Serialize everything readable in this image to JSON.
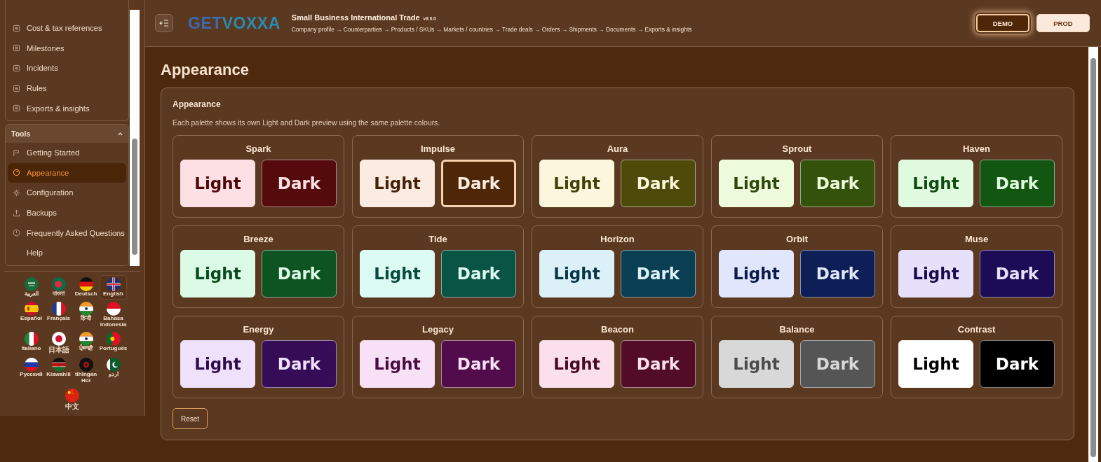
{
  "sidebar": {
    "items": [
      {
        "label": "Cost & tax references",
        "selected": false
      },
      {
        "label": "Milestones",
        "selected": false
      },
      {
        "label": "Incidents",
        "selected": false
      },
      {
        "label": "Rules",
        "selected": false
      },
      {
        "label": "Exports & insights",
        "selected": false
      }
    ],
    "tools": {
      "title": "Tools",
      "expanded": true,
      "items": [
        {
          "label": "Getting Started",
          "selected": false
        },
        {
          "label": "Appearance",
          "selected": true
        },
        {
          "label": "Configuration",
          "selected": false
        },
        {
          "label": "Backups",
          "selected": false
        },
        {
          "label": "Frequently Asked Questions",
          "selected": false
        },
        {
          "label": "Help",
          "selected": false
        }
      ]
    },
    "languages": [
      {
        "label": "العربية",
        "selected": false,
        "cjk": false
      },
      {
        "label": "বাংলা",
        "selected": false,
        "cjk": false
      },
      {
        "label": "Deutsch",
        "selected": false,
        "cjk": false
      },
      {
        "label": "English",
        "selected": true,
        "cjk": false
      },
      {
        "label": "Español",
        "selected": false,
        "cjk": false
      },
      {
        "label": "Français",
        "selected": false,
        "cjk": false
      },
      {
        "label": "हिन्दी",
        "selected": false,
        "cjk": false
      },
      {
        "label": "Bahasa Indonesia",
        "selected": false,
        "cjk": false
      },
      {
        "label": "Italiano",
        "selected": false,
        "cjk": false
      },
      {
        "label": "日本語",
        "selected": false,
        "cjk": true
      },
      {
        "label": "ਪੰਜਾਬੀ",
        "selected": false,
        "cjk": false
      },
      {
        "label": "Português",
        "selected": false,
        "cjk": false
      },
      {
        "label": "Русский",
        "selected": false,
        "cjk": false
      },
      {
        "label": "Kiswahili",
        "selected": false,
        "cjk": false
      },
      {
        "label": "tlhIngan Hol",
        "selected": false,
        "cjk": false
      },
      {
        "label": "اردو",
        "selected": false,
        "cjk": false
      },
      {
        "label": "中文",
        "selected": false,
        "cjk": true
      }
    ]
  },
  "header": {
    "logo": {
      "part_1": "GET",
      "part_2": "VOXXA"
    },
    "title": "Small Business International Trade",
    "version": "v9.0.0",
    "breadcrumb": "Company profile → Counterparties → Products / SKUs → Markets / countries → Trade deals → Orders → Shipments → Documents → Exports & insights",
    "environments": [
      {
        "label": "DEMO",
        "selected": true
      },
      {
        "label": "PROD",
        "selected": false
      }
    ]
  },
  "page": {
    "title": "Appearance",
    "card_title": "Appearance",
    "description": "Each palette shows its own Light and Dark preview using the same palette colours.",
    "palettes": [
      {
        "name": "Spark",
        "light": {
          "label": "Light",
          "color": "#fde0e4",
          "selected": false
        },
        "dark": {
          "label": "Dark",
          "color": "#550a0c",
          "selected": false
        }
      },
      {
        "name": "Impulse",
        "light": {
          "label": "Light",
          "color": "#fbebe0",
          "selected": false
        },
        "dark": {
          "label": "Dark",
          "color": "#4e2608",
          "selected": true
        }
      },
      {
        "name": "Aura",
        "light": {
          "label": "Light",
          "color": "#fbf6dc",
          "selected": false
        },
        "dark": {
          "label": "Dark",
          "color": "#4d4a0a",
          "selected": false
        }
      },
      {
        "name": "Sprout",
        "light": {
          "label": "Light",
          "color": "#edfbdc",
          "selected": false
        },
        "dark": {
          "label": "Dark",
          "color": "#34520c",
          "selected": false
        }
      },
      {
        "name": "Haven",
        "light": {
          "label": "Light",
          "color": "#e0fbe0",
          "selected": false
        },
        "dark": {
          "label": "Dark",
          "color": "#125612",
          "selected": false
        }
      },
      {
        "name": "Breeze",
        "light": {
          "label": "Light",
          "color": "#dcfbe6",
          "selected": false
        },
        "dark": {
          "label": "Dark",
          "color": "#0e5422",
          "selected": false
        }
      },
      {
        "name": "Tide",
        "light": {
          "label": "Light",
          "color": "#dcfbf3",
          "selected": false
        },
        "dark": {
          "label": "Dark",
          "color": "#0a5446",
          "selected": false
        }
      },
      {
        "name": "Horizon",
        "light": {
          "label": "Light",
          "color": "#dcf0f8",
          "selected": false
        },
        "dark": {
          "label": "Dark",
          "color": "#0a3e52",
          "selected": false
        }
      },
      {
        "name": "Orbit",
        "light": {
          "label": "Light",
          "color": "#e0e6fb",
          "selected": false
        },
        "dark": {
          "label": "Dark",
          "color": "#0e1e56",
          "selected": false
        }
      },
      {
        "name": "Muse",
        "light": {
          "label": "Light",
          "color": "#e6e0fb",
          "selected": false
        },
        "dark": {
          "label": "Dark",
          "color": "#1c0c56",
          "selected": false
        }
      },
      {
        "name": "Energy",
        "light": {
          "label": "Light",
          "color": "#efe0fb",
          "selected": false
        },
        "dark": {
          "label": "Dark",
          "color": "#360c56",
          "selected": false
        }
      },
      {
        "name": "Legacy",
        "light": {
          "label": "Light",
          "color": "#f8e0f6",
          "selected": false
        },
        "dark": {
          "label": "Dark",
          "color": "#520c4c",
          "selected": false
        }
      },
      {
        "name": "Beacon",
        "light": {
          "label": "Light",
          "color": "#fbe0ec",
          "selected": false
        },
        "dark": {
          "label": "Dark",
          "color": "#520c26",
          "selected": false
        }
      },
      {
        "name": "Balance",
        "light": {
          "label": "Light",
          "color": "#d8d8d8",
          "selected": false
        },
        "dark": {
          "label": "Dark",
          "color": "#555555",
          "selected": false
        }
      },
      {
        "name": "Contrast",
        "light": {
          "label": "Light",
          "color": "#ffffff",
          "selected": false
        },
        "dark": {
          "label": "Dark",
          "color": "#000000",
          "selected": false
        }
      }
    ],
    "reset_button": "Reset"
  }
}
